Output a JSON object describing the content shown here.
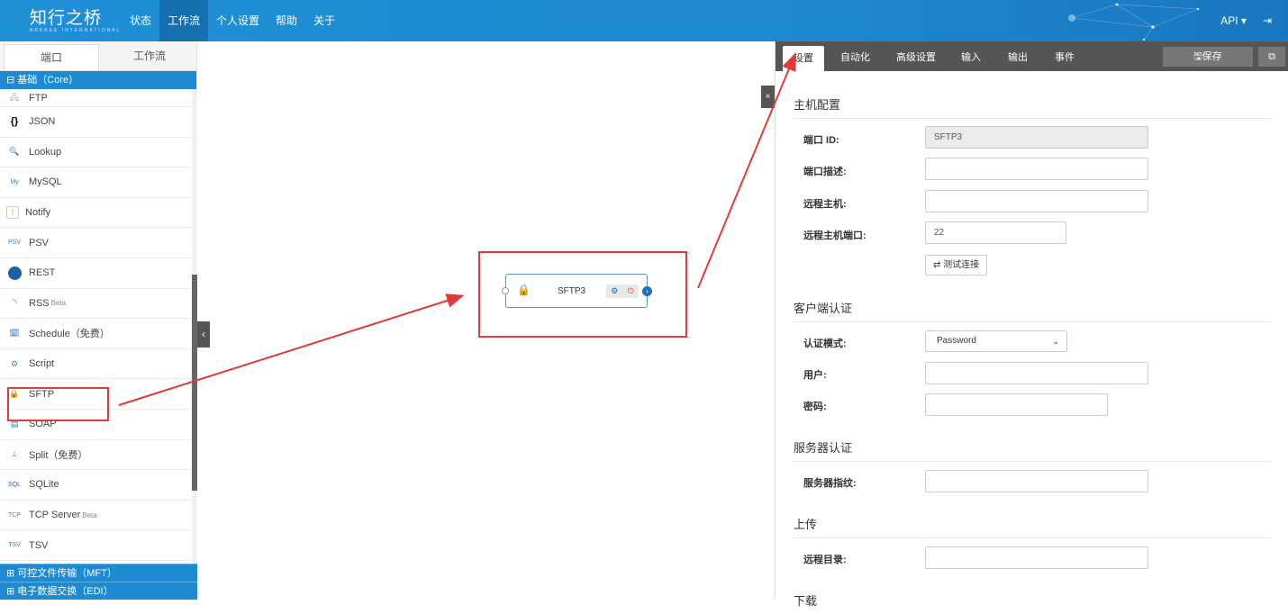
{
  "app": {
    "logo": "知行之桥",
    "logo_sub": "ARKBEE INTERNATIONAL"
  },
  "nav": [
    "状态",
    "工作流",
    "个人设置",
    "帮助",
    "关于"
  ],
  "topright": {
    "api_label": "API ▾",
    "logout_icon": "logout-icon"
  },
  "left_tabs": [
    "端口",
    "工作流"
  ],
  "core_group": "⊟ 基础（Core）",
  "connectors": [
    {
      "label": "FTP",
      "icon": "ftp-icon"
    },
    {
      "label": "JSON",
      "icon": "json-icon"
    },
    {
      "label": "Lookup",
      "icon": "lookup-icon"
    },
    {
      "label": "MySQL",
      "icon": "mysql-icon"
    },
    {
      "label": "Notify",
      "icon": "notify-icon"
    },
    {
      "label": "PSV",
      "icon": "psv-icon"
    },
    {
      "label": "REST",
      "icon": "rest-icon"
    },
    {
      "label": "RSS",
      "badge": "Beta",
      "icon": "rss-icon"
    },
    {
      "label": "Schedule（免费）",
      "icon": "schedule-icon"
    },
    {
      "label": "Script",
      "icon": "script-icon"
    },
    {
      "label": "SFTP",
      "icon": "sftp-icon"
    },
    {
      "label": "SOAP",
      "icon": "soap-icon"
    },
    {
      "label": "Split（免费）",
      "icon": "split-icon"
    },
    {
      "label": "SQLite",
      "icon": "sqlite-icon"
    },
    {
      "label": "TCP Server",
      "badge": "Beta",
      "icon": "tcp-server-icon"
    },
    {
      "label": "TSV",
      "icon": "tsv-icon"
    }
  ],
  "bottom_groups": [
    "⊞ 可控文件传输（MFT）",
    "⊞ 电子数据交换（EDI）"
  ],
  "canvas": {
    "node_title": "SFTP3"
  },
  "right_tabs": [
    "设置",
    "自动化",
    "高级设置",
    "输入",
    "输出",
    "事件"
  ],
  "save_label": "🖫保存",
  "sections": {
    "host": "主机配置",
    "client_auth": "客户端认证",
    "server_auth": "服务器认证",
    "upload": "上传",
    "download": "下载"
  },
  "fields": {
    "port_id": {
      "label": "端口 ID:",
      "value": "SFTP3"
    },
    "port_desc": {
      "label": "端口描述:",
      "value": ""
    },
    "remote_host": {
      "label": "远程主机:",
      "value": ""
    },
    "remote_port": {
      "label": "远程主机端口:",
      "value": "22"
    },
    "test_connection": "⇄ 测试连接",
    "auth_mode": {
      "label": "认证模式:",
      "value": "Password"
    },
    "user": {
      "label": "用户:",
      "value": ""
    },
    "password": {
      "label": "密码:",
      "value": ""
    },
    "server_fingerprint": {
      "label": "服务器指纹:",
      "value": ""
    },
    "remote_dir": {
      "label": "远程目录:",
      "value": ""
    }
  },
  "colors": {
    "topbar": "#1e8ad2",
    "highlight": "#e03a3a",
    "tabbar": "#555555"
  }
}
